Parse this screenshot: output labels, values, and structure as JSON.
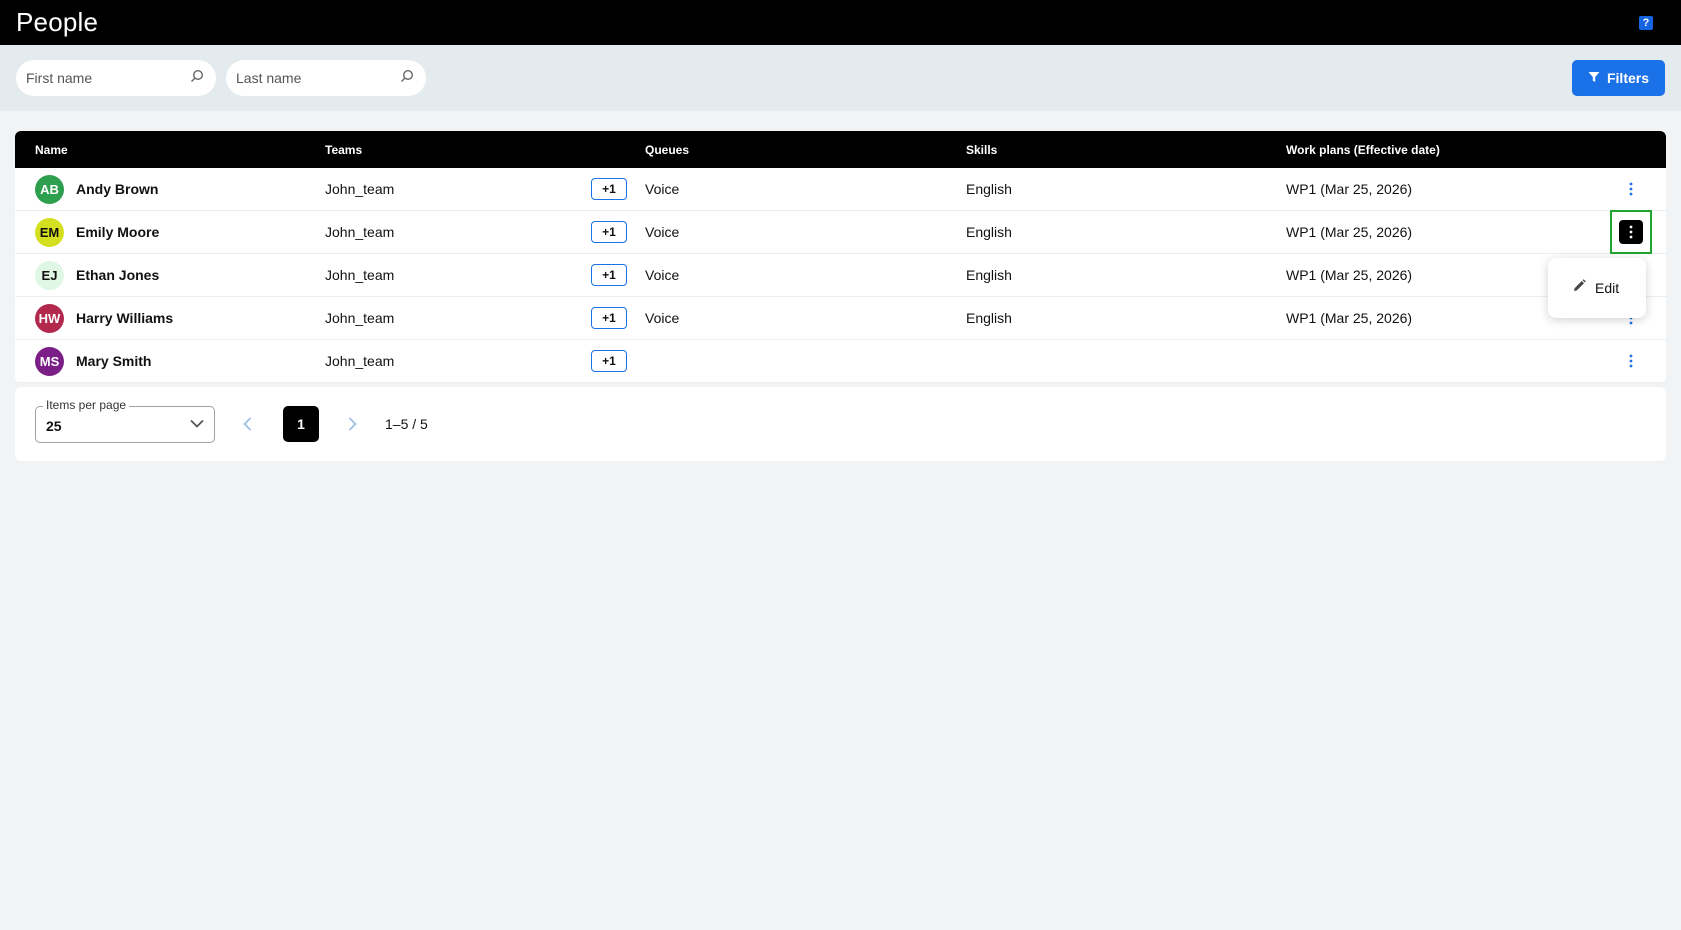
{
  "header": {
    "title": "People",
    "help_icon": "?"
  },
  "filters": {
    "first_name_placeholder": "First name",
    "last_name_placeholder": "Last name",
    "filters_button": "Filters"
  },
  "table": {
    "columns": [
      "Name",
      "Teams",
      "Queues",
      "Skills",
      "Work plans (Effective date)"
    ],
    "rows": [
      {
        "initials": "AB",
        "avatar_color": "#2e9e4f",
        "avatar_text_color": "#ffffff",
        "name": "Andy Brown",
        "team": "John_team",
        "extra": "+1",
        "queue": "Voice",
        "skill": "English",
        "work_plan": "WP1 (Mar 25, 2026)"
      },
      {
        "initials": "EM",
        "avatar_color": "#d4e01f",
        "avatar_text_color": "#111111",
        "name": "Emily Moore",
        "team": "John_team",
        "extra": "+1",
        "queue": "Voice",
        "skill": "English",
        "work_plan": "WP1 (Mar 25, 2026)"
      },
      {
        "initials": "EJ",
        "avatar_color": "#dff7e4",
        "avatar_text_color": "#111111",
        "name": "Ethan Jones",
        "team": "John_team",
        "extra": "+1",
        "queue": "Voice",
        "skill": "English",
        "work_plan": "WP1 (Mar 25, 2026)"
      },
      {
        "initials": "HW",
        "avatar_color": "#b3294e",
        "avatar_text_color": "#ffffff",
        "name": "Harry Williams",
        "team": "John_team",
        "extra": "+1",
        "queue": "Voice",
        "skill": "English",
        "work_plan": "WP1 (Mar 25, 2026)"
      },
      {
        "initials": "MS",
        "avatar_color": "#7b1f86",
        "avatar_text_color": "#ffffff",
        "name": "Mary Smith",
        "team": "John_team",
        "extra": "+1",
        "queue": "",
        "skill": "",
        "work_plan": ""
      }
    ]
  },
  "context_menu": {
    "edit_label": "Edit"
  },
  "pagination": {
    "items_per_page_label": "Items per page",
    "items_per_page_value": "25",
    "current_page": "1",
    "range": "1–5 / 5"
  },
  "colors": {
    "accent": "#1b72e8",
    "highlight": "#22a530"
  }
}
